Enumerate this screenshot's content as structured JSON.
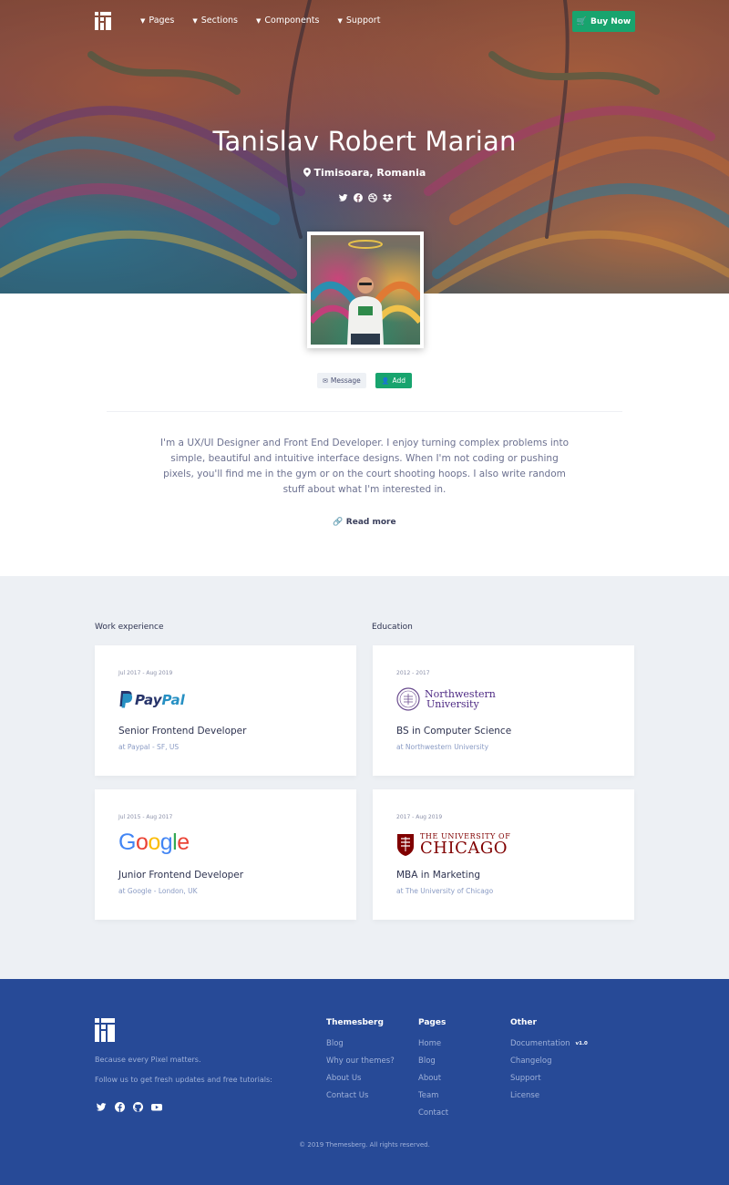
{
  "nav": {
    "items": [
      "Pages",
      "Sections",
      "Components",
      "Support"
    ],
    "buy_label": "Buy Now"
  },
  "profile": {
    "name": "Tanislav Robert Marian",
    "location": "Timisoara, Romania",
    "social_icons": [
      "twitter-icon",
      "facebook-icon",
      "dribbble-icon",
      "dropbox-icon"
    ],
    "message_label": "Message",
    "add_label": "Add",
    "bio": "I'm a UX/UI Designer and Front End Developer. I enjoy turning complex problems into simple, beautiful and intuitive interface designs. When I'm not coding or pushing pixels, you'll find me in the gym or on the court shooting hoops. I also write random stuff about what I'm interested in.",
    "read_more": "Read more"
  },
  "work": {
    "title": "Work experience",
    "items": [
      {
        "date": "Jul 2017 - Aug 2019",
        "logo": "PayPal",
        "role": "Senior Frontend Developer",
        "place": "at Paypal - SF, US"
      },
      {
        "date": "Jul 2015 - Aug 2017",
        "logo": "Google",
        "role": "Junior Frontend Developer",
        "place": "at Google - London, UK"
      }
    ]
  },
  "education": {
    "title": "Education",
    "items": [
      {
        "date": "2012 - 2017",
        "logo_line1": "Northwestern",
        "logo_line2": "University",
        "role": "BS in Computer Science",
        "place": "at Northwestern University"
      },
      {
        "date": "2017 - Aug 2019",
        "logo_line1": "THE UNIVERSITY OF",
        "logo_line2": "CHICAGO",
        "role": "MBA in Marketing",
        "place": "at The University of Chicago"
      }
    ]
  },
  "footer": {
    "tagline": "Because every Pixel matters.",
    "follow": "Follow us to get fresh updates and free tutorials:",
    "social_icons": [
      "twitter-icon",
      "facebook-icon",
      "github-icon",
      "youtube-icon"
    ],
    "columns": [
      {
        "heading": "Themesberg",
        "links": [
          "Blog",
          "Why our themes?",
          "About Us",
          "Contact Us"
        ]
      },
      {
        "heading": "Pages",
        "links": [
          "Home",
          "Blog",
          "About",
          "Team",
          "Contact"
        ]
      },
      {
        "heading": "Other",
        "links": [
          "Documentation",
          "Changelog",
          "Support",
          "License"
        ]
      }
    ],
    "doc_badge": "v1.0",
    "copyright": "© 2019 Themesberg. All rights reserved."
  },
  "colors": {
    "accent_green": "#18a46e",
    "footer_blue": "#274a97",
    "section_gray": "#edf0f4"
  }
}
